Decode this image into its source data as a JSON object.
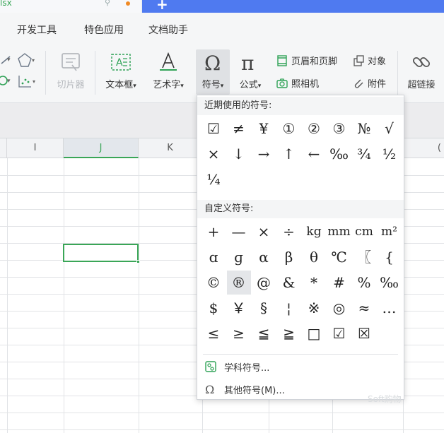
{
  "tab": {
    "file_name_fragment": "lsx",
    "new_tab_icon": "plus-icon"
  },
  "menu": {
    "items": [
      "开发工具",
      "特色应用",
      "文档助手"
    ]
  },
  "ribbon": {
    "slice_tool": "切片器",
    "textbox": "文本框",
    "wordart": "艺术字",
    "symbol": "符号",
    "formula": "公式",
    "header_footer": "页眉和页脚",
    "object": "对象",
    "camera": "照相机",
    "attachment": "附件",
    "hyperlink": "超链接",
    "dropdown_arrow": "▾"
  },
  "sheet": {
    "columns": [
      "I",
      "J",
      "K"
    ],
    "selected_column": "J",
    "partial_column": "("
  },
  "symbol_menu": {
    "recent_title": "近期使用的符号:",
    "recent": [
      "☑",
      "≠",
      "¥",
      "①",
      "②",
      "③",
      "№",
      "√",
      "×",
      "↓",
      "→",
      "↑",
      "←",
      "‰",
      "¾",
      "½",
      "¼"
    ],
    "custom_title": "自定义符号:",
    "custom": [
      "+",
      "—",
      "×",
      "÷",
      "kg",
      "mm",
      "cm",
      "m²",
      "ɑ",
      "ɡ",
      "α",
      "β",
      "θ",
      "℃",
      "〖",
      "{",
      "©",
      "®",
      "@",
      "&",
      "*",
      "#",
      "%",
      "‰",
      "$",
      "￥",
      "§",
      "¦",
      "※",
      "◎",
      "≈",
      "…",
      "≤",
      "≥",
      "≦",
      "≧",
      "□",
      "☑",
      "☒"
    ],
    "subject_symbols": "学科符号...",
    "other_symbols": "其他符号(M)..."
  },
  "watermark": "Soft购物"
}
